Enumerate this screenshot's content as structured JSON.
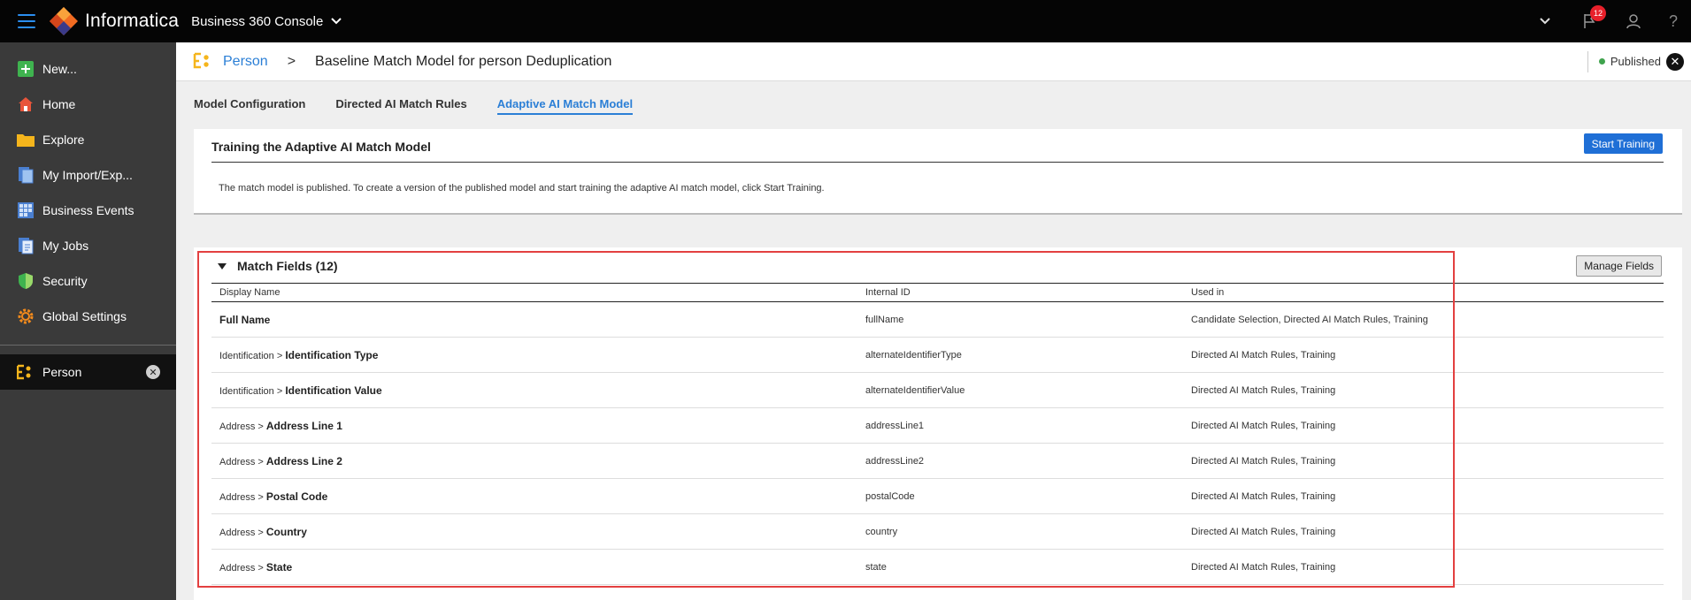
{
  "topbar": {
    "brand": "Informatica",
    "console": "Business 360 Console",
    "notification_count": "12",
    "help": "?"
  },
  "sidebar": {
    "items": [
      {
        "label": "New...",
        "icon": "plus-icon"
      },
      {
        "label": "Home",
        "icon": "home-icon"
      },
      {
        "label": "Explore",
        "icon": "folder-icon"
      },
      {
        "label": "My Import/Exp...",
        "icon": "import-export-icon"
      },
      {
        "label": "Business Events",
        "icon": "events-grid-icon"
      },
      {
        "label": "My Jobs",
        "icon": "jobs-icon"
      },
      {
        "label": "Security",
        "icon": "shield-icon"
      },
      {
        "label": "Global Settings",
        "icon": "gear-icon"
      }
    ],
    "open_item": {
      "label": "Person",
      "close": "✕"
    }
  },
  "header": {
    "breadcrumb_link": "Person",
    "breadcrumb_sep": ">",
    "title": "Baseline Match Model for person Deduplication",
    "status": "Published",
    "close": "✕"
  },
  "tabs": [
    {
      "label": "Model Configuration",
      "active": false
    },
    {
      "label": "Directed AI Match Rules",
      "active": false
    },
    {
      "label": "Adaptive AI Match Model",
      "active": true
    }
  ],
  "training": {
    "title": "Training the Adaptive AI Match Model",
    "button": "Start Training",
    "message": "The match model is published. To create a version of the published model and start training the adaptive AI match model, click Start Training."
  },
  "match_fields": {
    "title": "Match Fields (12)",
    "manage_button": "Manage Fields",
    "columns": [
      "Display Name",
      "Internal ID",
      "Used in"
    ],
    "rows": [
      {
        "prefix": "",
        "name": "Full Name",
        "id": "fullName",
        "used": "Candidate Selection, Directed AI Match Rules, Training"
      },
      {
        "prefix": "Identification > ",
        "name": "Identification Type",
        "id": "alternateIdentifierType",
        "used": "Directed AI Match Rules, Training"
      },
      {
        "prefix": "Identification > ",
        "name": "Identification Value",
        "id": "alternateIdentifierValue",
        "used": "Directed AI Match Rules, Training"
      },
      {
        "prefix": "Address > ",
        "name": "Address Line 1",
        "id": "addressLine1",
        "used": "Directed AI Match Rules, Training"
      },
      {
        "prefix": "Address > ",
        "name": "Address Line 2",
        "id": "addressLine2",
        "used": "Directed AI Match Rules, Training"
      },
      {
        "prefix": "Address > ",
        "name": "Postal Code",
        "id": "postalCode",
        "used": "Directed AI Match Rules, Training"
      },
      {
        "prefix": "Address > ",
        "name": "Country",
        "id": "country",
        "used": "Directed AI Match Rules, Training"
      },
      {
        "prefix": "Address > ",
        "name": "State",
        "id": "state",
        "used": "Directed AI Match Rules, Training"
      }
    ]
  },
  "colors": {
    "accent": "#2b7fd6",
    "button": "#1f6fd6",
    "published": "#3fa34d",
    "highlight": "#e34040",
    "badge": "#e8202a"
  }
}
